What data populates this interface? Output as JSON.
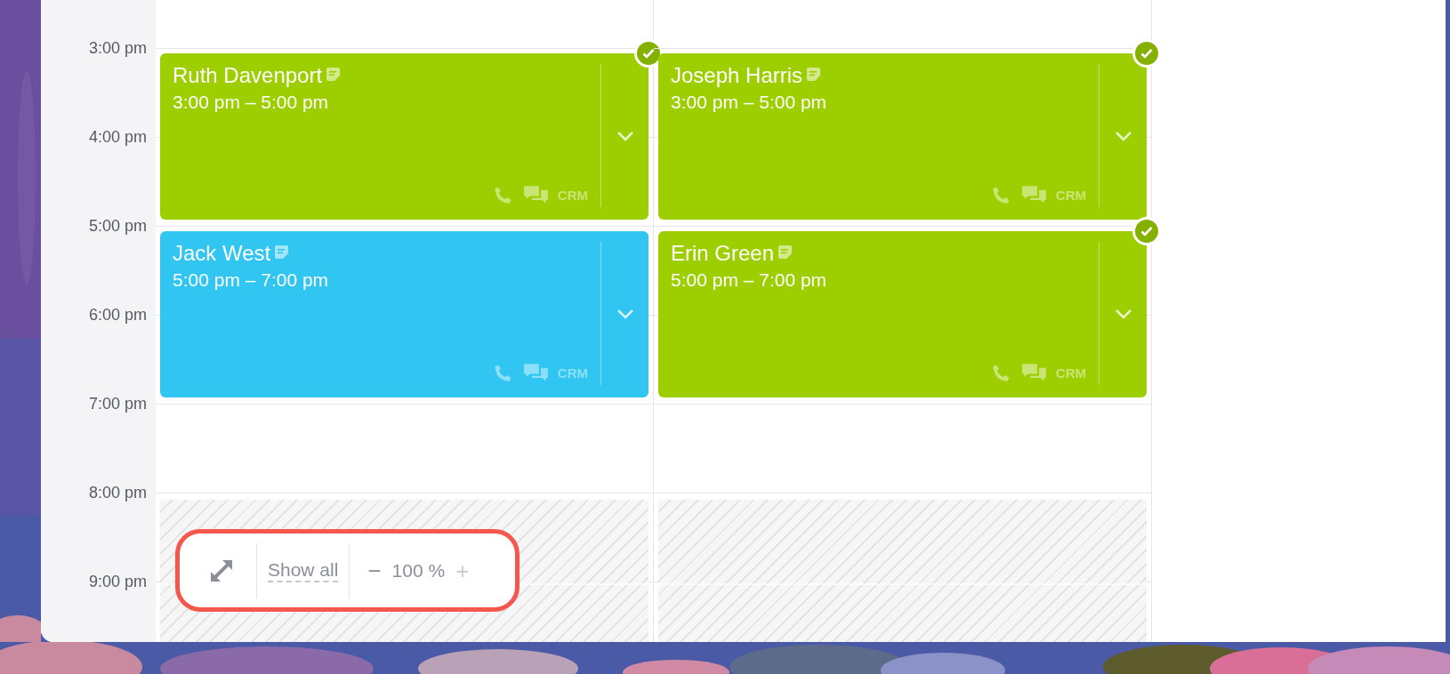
{
  "time_labels": [
    "3:00 pm",
    "4:00 pm",
    "5:00 pm",
    "6:00 pm",
    "7:00 pm",
    "8:00 pm",
    "9:00 pm"
  ],
  "days": [
    {
      "events": [
        {
          "name": "Ruth Davenport",
          "time": "3:00 pm – 5:00 pm",
          "color": "#9dcf00",
          "confirmed": true,
          "crm": "CRM"
        },
        {
          "name": "Jack West",
          "time": "5:00 pm – 7:00 pm",
          "color": "#31c5f2",
          "confirmed": false,
          "crm": "CRM"
        }
      ]
    },
    {
      "events": [
        {
          "name": "Joseph Harris",
          "time": "3:00 pm – 5:00 pm",
          "color": "#9dcf00",
          "confirmed": true,
          "crm": "CRM"
        },
        {
          "name": "Erin Green",
          "time": "5:00 pm – 7:00 pm",
          "color": "#9dcf00",
          "confirmed": true,
          "crm": "CRM"
        }
      ]
    }
  ],
  "zoom_control": {
    "show_all": "Show all",
    "minus": "−",
    "zoom": "100 %",
    "plus": "+",
    "plus_disabled": true
  }
}
